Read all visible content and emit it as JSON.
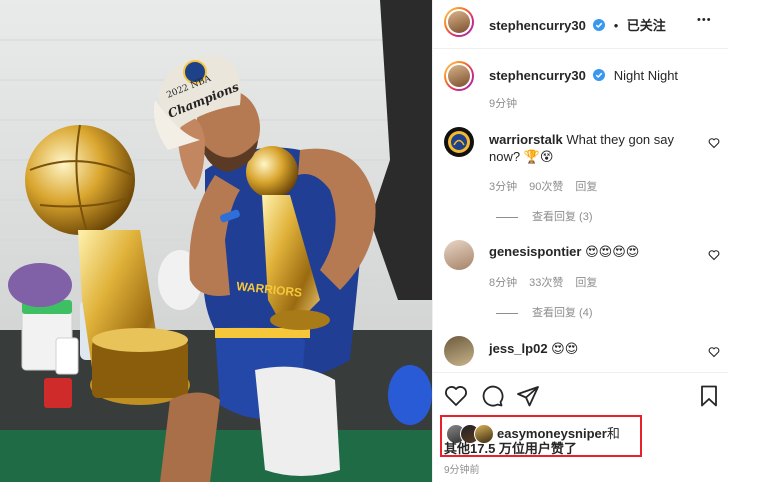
{
  "header": {
    "username": "stephencurry30",
    "separator": "•",
    "follow_status": "已关注",
    "more_label": "•••"
  },
  "caption": {
    "username": "stephencurry30",
    "text": "Night Night",
    "time": "9分钟"
  },
  "photo": {
    "hat_text_top": "2022 NBA",
    "hat_text_bottom": "Champions",
    "jersey_text": "WARRIORS"
  },
  "comments": [
    {
      "username": "warriorstalk",
      "text": "What they gon say now? 🏆😵",
      "time": "3分钟",
      "likes": "90次赞",
      "reply": "回复",
      "view_replies": "查看回复 (3)"
    },
    {
      "username": "genesispontier",
      "text": "😍😍😍😍",
      "time": "8分钟",
      "likes": "33次赞",
      "reply": "回复",
      "view_replies": "查看回复 (4)"
    },
    {
      "username": "jess_lp02",
      "text": "😍😍"
    }
  ],
  "likes": {
    "line1_user": "easymoneysniper",
    "line1_suffix": "和",
    "line2": "其他17.5 万位用户赞了"
  },
  "post_time": "9分钟前",
  "colors": {
    "verified": "#3897f0",
    "highlight_box": "#e8202a",
    "text_muted": "#8e8e8e"
  }
}
